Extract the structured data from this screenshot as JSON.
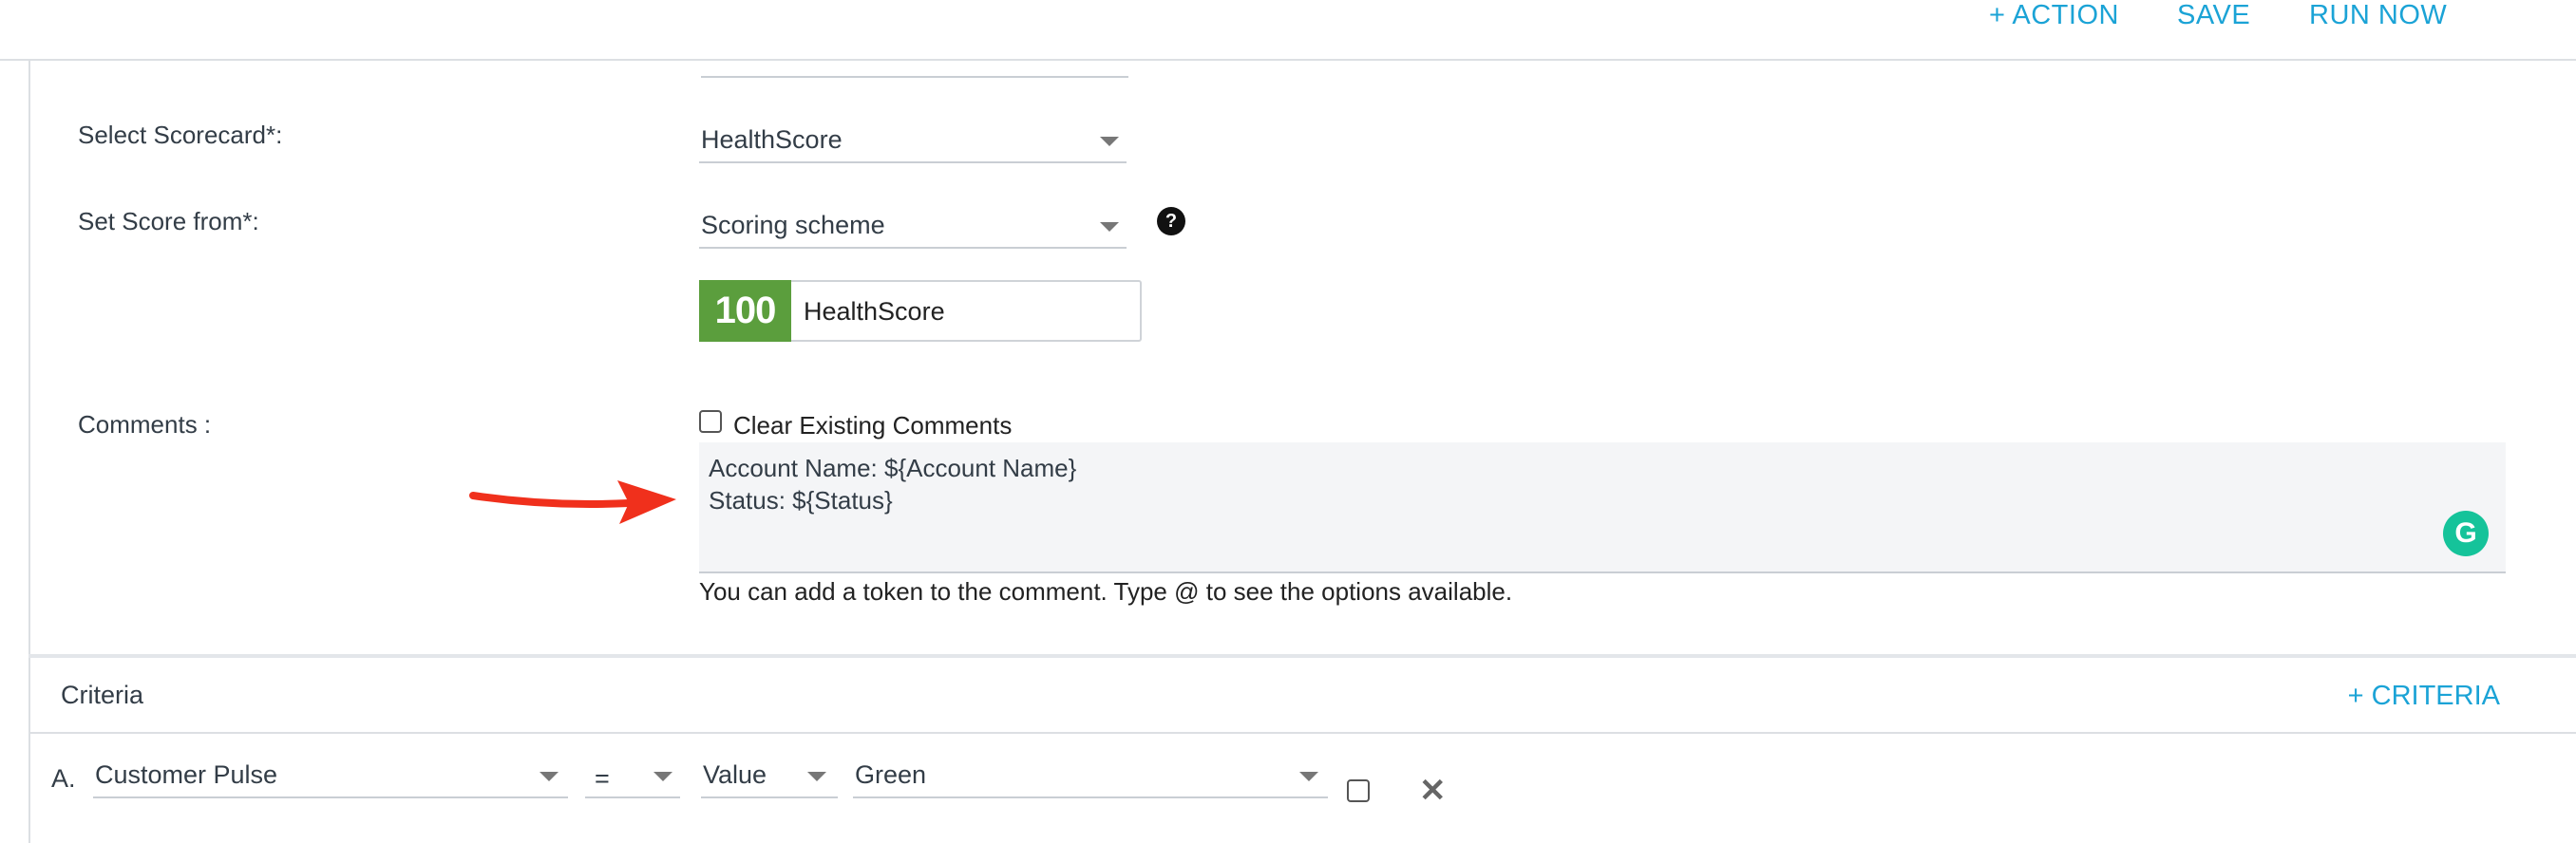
{
  "toolbar": {
    "action_label": "+ ACTION",
    "save_label": "SAVE",
    "run_now_label": "RUN NOW"
  },
  "form": {
    "scorecard_label": "Select Scorecard*:",
    "scorecard_value": "HealthScore",
    "set_score_label": "Set Score from*:",
    "set_score_value": "Scoring scheme",
    "help_icon": "question-circle-icon",
    "score_value": "100",
    "score_name": "HealthScore",
    "score_color": "#5b9e3d",
    "comments_label": "Comments :",
    "clear_comments_label": "Clear Existing Comments",
    "comment_lines": [
      "Account Name: ${Account Name}",
      "Status: ${Status}"
    ],
    "comment_hint": "You can add a token to the comment. Type @ to see the options available."
  },
  "criteria": {
    "title": "Criteria",
    "add_label": "+ CRITERIA",
    "rows": [
      {
        "letter": "A.",
        "field": "Customer Pulse",
        "operator": "=",
        "type": "Value",
        "value": "Green"
      }
    ]
  },
  "colors": {
    "accent": "#1ba3d6",
    "arrow": "#f0301c",
    "grammarly": "#15c39a"
  }
}
